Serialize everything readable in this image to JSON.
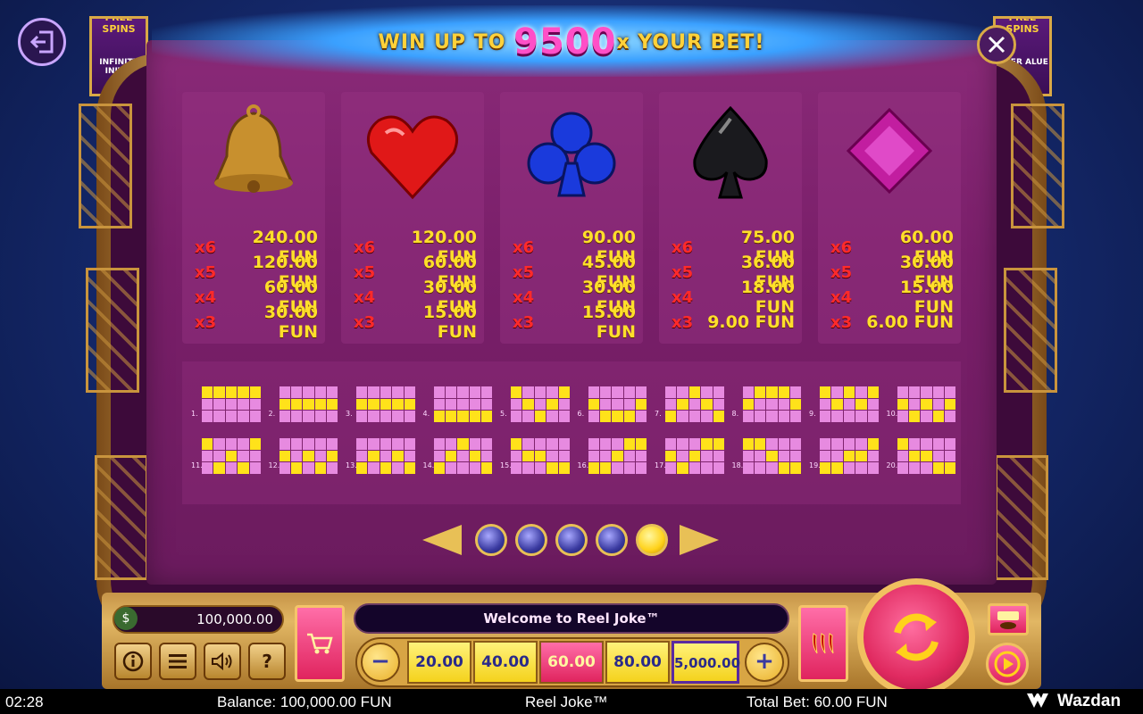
{
  "banner": {
    "pre": "WIN UP TO",
    "big": "9500",
    "post": "x YOUR BET!"
  },
  "side_panels": {
    "left_title": "FREE SPINS",
    "left_text": "INFINITE INITIA",
    "right_title": "FREE SPINS",
    "right_text": "PLIER ALUE"
  },
  "symbols": [
    {
      "icon": "bell-icon",
      "pays": [
        {
          "mult": "x6",
          "amt": "240.00 FUN"
        },
        {
          "mult": "x5",
          "amt": "120.00 FUN"
        },
        {
          "mult": "x4",
          "amt": "60.00 FUN"
        },
        {
          "mult": "x3",
          "amt": "30.00 FUN"
        }
      ]
    },
    {
      "icon": "heart-icon",
      "pays": [
        {
          "mult": "x6",
          "amt": "120.00 FUN"
        },
        {
          "mult": "x5",
          "amt": "60.00 FUN"
        },
        {
          "mult": "x4",
          "amt": "30.00 FUN"
        },
        {
          "mult": "x3",
          "amt": "15.00 FUN"
        }
      ]
    },
    {
      "icon": "club-icon",
      "pays": [
        {
          "mult": "x6",
          "amt": "90.00 FUN"
        },
        {
          "mult": "x5",
          "amt": "45.00 FUN"
        },
        {
          "mult": "x4",
          "amt": "30.00 FUN"
        },
        {
          "mult": "x3",
          "amt": "15.00 FUN"
        }
      ]
    },
    {
      "icon": "spade-icon",
      "pays": [
        {
          "mult": "x6",
          "amt": "75.00 FUN"
        },
        {
          "mult": "x5",
          "amt": "36.00 FUN"
        },
        {
          "mult": "x4",
          "amt": "18.00 FUN"
        },
        {
          "mult": "x3",
          "amt": "9.00 FUN"
        }
      ]
    },
    {
      "icon": "diamond-icon",
      "pays": [
        {
          "mult": "x6",
          "amt": "60.00 FUN"
        },
        {
          "mult": "x5",
          "amt": "30.00 FUN"
        },
        {
          "mult": "x4",
          "amt": "15.00 FUN"
        },
        {
          "mult": "x3",
          "amt": "6.00 FUN"
        }
      ]
    }
  ],
  "paylines": [
    {
      "n": "1.",
      "rows": [
        0,
        0,
        0,
        0,
        0
      ]
    },
    {
      "n": "2.",
      "rows": [
        1,
        1,
        1,
        1,
        1
      ]
    },
    {
      "n": "3.",
      "rows": [
        1,
        1,
        1,
        1,
        1
      ]
    },
    {
      "n": "4.",
      "rows": [
        2,
        2,
        2,
        2,
        2
      ]
    },
    {
      "n": "5.",
      "rows": [
        0,
        1,
        2,
        1,
        0
      ]
    },
    {
      "n": "6.",
      "rows": [
        1,
        2,
        2,
        2,
        1
      ]
    },
    {
      "n": "7.",
      "rows": [
        2,
        1,
        0,
        1,
        2
      ]
    },
    {
      "n": "8.",
      "rows": [
        1,
        0,
        0,
        0,
        1
      ]
    },
    {
      "n": "9.",
      "rows": [
        0,
        1,
        0,
        1,
        0
      ]
    },
    {
      "n": "10.",
      "rows": [
        1,
        2,
        1,
        2,
        1
      ]
    },
    {
      "n": "11.",
      "rows": [
        0,
        2,
        1,
        2,
        0
      ]
    },
    {
      "n": "12.",
      "rows": [
        1,
        2,
        1,
        2,
        1
      ]
    },
    {
      "n": "13.",
      "rows": [
        2,
        1,
        2,
        1,
        2
      ]
    },
    {
      "n": "14.",
      "rows": [
        2,
        1,
        0,
        1,
        2
      ]
    },
    {
      "n": "15.",
      "rows": [
        0,
        1,
        1,
        2,
        2
      ]
    },
    {
      "n": "16.",
      "rows": [
        2,
        2,
        1,
        0,
        0
      ]
    },
    {
      "n": "17.",
      "rows": [
        1,
        2,
        1,
        0,
        0
      ]
    },
    {
      "n": "18.",
      "rows": [
        0,
        0,
        1,
        2,
        2
      ]
    },
    {
      "n": "19.",
      "rows": [
        2,
        2,
        1,
        1,
        0
      ]
    },
    {
      "n": "20.",
      "rows": [
        0,
        1,
        1,
        2,
        2
      ]
    }
  ],
  "pager": {
    "pages": 5,
    "active": 5
  },
  "console": {
    "balance": "100,000.00",
    "message": "Welcome to Reel Joke™",
    "bets": [
      "20.00",
      "40.00",
      "60.00",
      "80.00",
      "5,000.00"
    ],
    "selected_bet": 2,
    "minus": "−",
    "plus": "+",
    "help": "?"
  },
  "status_bar": {
    "time": "02:28",
    "balance": "Balance: 100,000.00 FUN",
    "game": "Reel Joke™",
    "total_bet": "Total Bet: 60.00 FUN",
    "brand": "Wazdan"
  }
}
